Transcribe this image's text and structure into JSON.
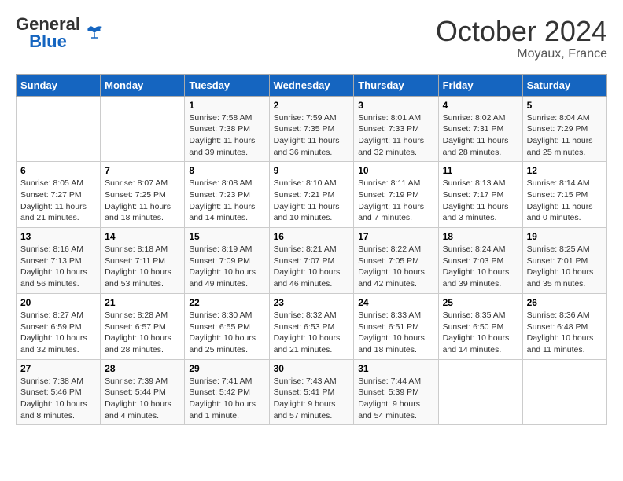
{
  "header": {
    "logo_line1": "General",
    "logo_line2": "Blue",
    "month": "October 2024",
    "location": "Moyaux, France"
  },
  "columns": [
    "Sunday",
    "Monday",
    "Tuesday",
    "Wednesday",
    "Thursday",
    "Friday",
    "Saturday"
  ],
  "weeks": [
    [
      {
        "day": "",
        "info": ""
      },
      {
        "day": "",
        "info": ""
      },
      {
        "day": "1",
        "info": "Sunrise: 7:58 AM\nSunset: 7:38 PM\nDaylight: 11 hours and 39 minutes."
      },
      {
        "day": "2",
        "info": "Sunrise: 7:59 AM\nSunset: 7:35 PM\nDaylight: 11 hours and 36 minutes."
      },
      {
        "day": "3",
        "info": "Sunrise: 8:01 AM\nSunset: 7:33 PM\nDaylight: 11 hours and 32 minutes."
      },
      {
        "day": "4",
        "info": "Sunrise: 8:02 AM\nSunset: 7:31 PM\nDaylight: 11 hours and 28 minutes."
      },
      {
        "day": "5",
        "info": "Sunrise: 8:04 AM\nSunset: 7:29 PM\nDaylight: 11 hours and 25 minutes."
      }
    ],
    [
      {
        "day": "6",
        "info": "Sunrise: 8:05 AM\nSunset: 7:27 PM\nDaylight: 11 hours and 21 minutes."
      },
      {
        "day": "7",
        "info": "Sunrise: 8:07 AM\nSunset: 7:25 PM\nDaylight: 11 hours and 18 minutes."
      },
      {
        "day": "8",
        "info": "Sunrise: 8:08 AM\nSunset: 7:23 PM\nDaylight: 11 hours and 14 minutes."
      },
      {
        "day": "9",
        "info": "Sunrise: 8:10 AM\nSunset: 7:21 PM\nDaylight: 11 hours and 10 minutes."
      },
      {
        "day": "10",
        "info": "Sunrise: 8:11 AM\nSunset: 7:19 PM\nDaylight: 11 hours and 7 minutes."
      },
      {
        "day": "11",
        "info": "Sunrise: 8:13 AM\nSunset: 7:17 PM\nDaylight: 11 hours and 3 minutes."
      },
      {
        "day": "12",
        "info": "Sunrise: 8:14 AM\nSunset: 7:15 PM\nDaylight: 11 hours and 0 minutes."
      }
    ],
    [
      {
        "day": "13",
        "info": "Sunrise: 8:16 AM\nSunset: 7:13 PM\nDaylight: 10 hours and 56 minutes."
      },
      {
        "day": "14",
        "info": "Sunrise: 8:18 AM\nSunset: 7:11 PM\nDaylight: 10 hours and 53 minutes."
      },
      {
        "day": "15",
        "info": "Sunrise: 8:19 AM\nSunset: 7:09 PM\nDaylight: 10 hours and 49 minutes."
      },
      {
        "day": "16",
        "info": "Sunrise: 8:21 AM\nSunset: 7:07 PM\nDaylight: 10 hours and 46 minutes."
      },
      {
        "day": "17",
        "info": "Sunrise: 8:22 AM\nSunset: 7:05 PM\nDaylight: 10 hours and 42 minutes."
      },
      {
        "day": "18",
        "info": "Sunrise: 8:24 AM\nSunset: 7:03 PM\nDaylight: 10 hours and 39 minutes."
      },
      {
        "day": "19",
        "info": "Sunrise: 8:25 AM\nSunset: 7:01 PM\nDaylight: 10 hours and 35 minutes."
      }
    ],
    [
      {
        "day": "20",
        "info": "Sunrise: 8:27 AM\nSunset: 6:59 PM\nDaylight: 10 hours and 32 minutes."
      },
      {
        "day": "21",
        "info": "Sunrise: 8:28 AM\nSunset: 6:57 PM\nDaylight: 10 hours and 28 minutes."
      },
      {
        "day": "22",
        "info": "Sunrise: 8:30 AM\nSunset: 6:55 PM\nDaylight: 10 hours and 25 minutes."
      },
      {
        "day": "23",
        "info": "Sunrise: 8:32 AM\nSunset: 6:53 PM\nDaylight: 10 hours and 21 minutes."
      },
      {
        "day": "24",
        "info": "Sunrise: 8:33 AM\nSunset: 6:51 PM\nDaylight: 10 hours and 18 minutes."
      },
      {
        "day": "25",
        "info": "Sunrise: 8:35 AM\nSunset: 6:50 PM\nDaylight: 10 hours and 14 minutes."
      },
      {
        "day": "26",
        "info": "Sunrise: 8:36 AM\nSunset: 6:48 PM\nDaylight: 10 hours and 11 minutes."
      }
    ],
    [
      {
        "day": "27",
        "info": "Sunrise: 7:38 AM\nSunset: 5:46 PM\nDaylight: 10 hours and 8 minutes."
      },
      {
        "day": "28",
        "info": "Sunrise: 7:39 AM\nSunset: 5:44 PM\nDaylight: 10 hours and 4 minutes."
      },
      {
        "day": "29",
        "info": "Sunrise: 7:41 AM\nSunset: 5:42 PM\nDaylight: 10 hours and 1 minute."
      },
      {
        "day": "30",
        "info": "Sunrise: 7:43 AM\nSunset: 5:41 PM\nDaylight: 9 hours and 57 minutes."
      },
      {
        "day": "31",
        "info": "Sunrise: 7:44 AM\nSunset: 5:39 PM\nDaylight: 9 hours and 54 minutes."
      },
      {
        "day": "",
        "info": ""
      },
      {
        "day": "",
        "info": ""
      }
    ]
  ]
}
